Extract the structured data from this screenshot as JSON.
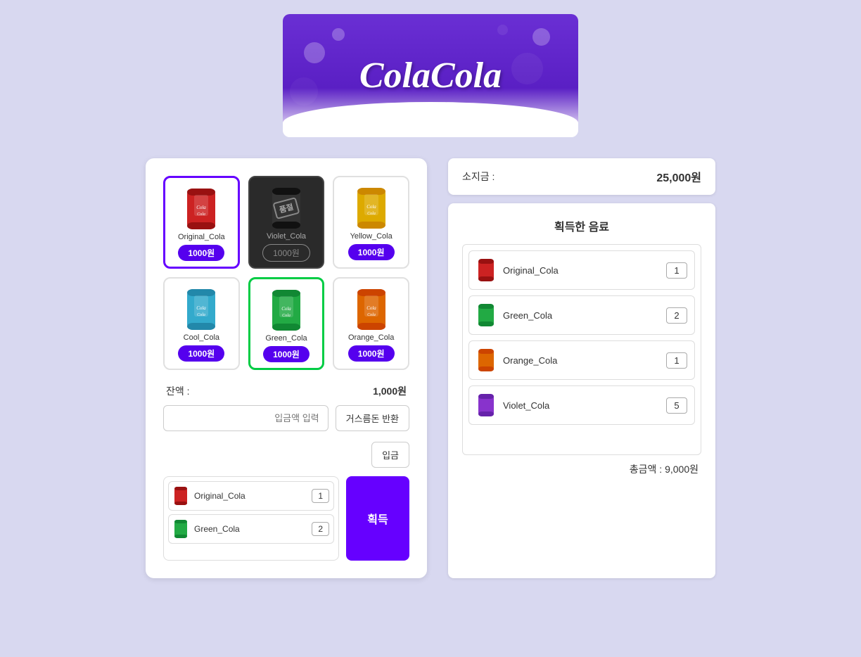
{
  "header": {
    "logo_text": "ColaCola"
  },
  "vending": {
    "products": [
      {
        "id": "original_cola",
        "name": "Original_Cola",
        "price": "1000원",
        "color": "red",
        "selected": true,
        "out_of_stock": false
      },
      {
        "id": "violet_cola",
        "name": "Violet_Cola",
        "price": "1000원",
        "color": "dark",
        "selected": false,
        "out_of_stock": true
      },
      {
        "id": "yellow_cola",
        "name": "Yellow_Cola",
        "price": "1000원",
        "color": "yellow",
        "selected": false,
        "out_of_stock": false
      },
      {
        "id": "cool_cola",
        "name": "Cool_Cola",
        "price": "1000원",
        "color": "cyan",
        "selected": false,
        "out_of_stock": false
      },
      {
        "id": "green_cola",
        "name": "Green_Cola",
        "price": "1000원",
        "color": "green",
        "selected": true,
        "out_of_stock": false
      },
      {
        "id": "orange_cola",
        "name": "Orange_Cola",
        "price": "1000원",
        "color": "orange",
        "selected": false,
        "out_of_stock": false
      }
    ],
    "balance_label": "잔액 :",
    "balance_value": "1,000원",
    "refund_btn": "거스름돈 반환",
    "amount_placeholder": "입금액 입력",
    "deposit_btn": "입금",
    "acquire_btn": "획득",
    "cart": [
      {
        "name": "Original_Cola",
        "qty": "1",
        "color": "red"
      },
      {
        "name": "Green_Cola",
        "qty": "2",
        "color": "green"
      }
    ]
  },
  "player": {
    "cash_label": "소지금 :",
    "cash_value": "25,000원"
  },
  "acquired": {
    "title": "획득한 음료",
    "items": [
      {
        "name": "Original_Cola",
        "qty": "1",
        "color": "red"
      },
      {
        "name": "Green_Cola",
        "qty": "2",
        "color": "green"
      },
      {
        "name": "Orange_Cola",
        "qty": "1",
        "color": "orange"
      },
      {
        "name": "Violet_Cola",
        "qty": "5",
        "color": "violet"
      }
    ],
    "total_label": "총금액 : 9,000원"
  }
}
